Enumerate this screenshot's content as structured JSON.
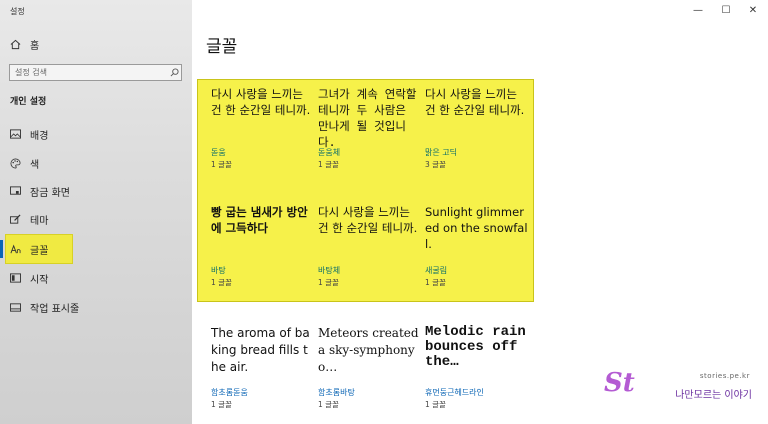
{
  "app_title": "설정",
  "sidebar": {
    "home_label": "홈",
    "search_placeholder": "설정 검색",
    "section_title": "개인 설정",
    "items": [
      {
        "label": "배경",
        "icon": "picture-icon"
      },
      {
        "label": "색",
        "icon": "palette-icon"
      },
      {
        "label": "잠금 화면",
        "icon": "lock-screen-icon"
      },
      {
        "label": "테마",
        "icon": "brush-icon"
      },
      {
        "label": "글꼴",
        "icon": "font-icon",
        "active": true
      },
      {
        "label": "시작",
        "icon": "start-icon"
      },
      {
        "label": "작업 표시줄",
        "icon": "taskbar-icon"
      }
    ]
  },
  "window_controls": {
    "minimize": "—",
    "maximize": "☐",
    "close": "✕"
  },
  "main": {
    "title": "글꼴",
    "fonts": [
      {
        "sample": "다시 사랑을 느끼는 건 한 순간일 테니까.",
        "name": "돋움",
        "count": "1 글꼴"
      },
      {
        "sample": "그녀가 계속 연락할 테니까 두 사람은 만나게 될 것입니다.",
        "name": "돋움체",
        "count": "1 글꼴"
      },
      {
        "sample": "다시 사랑을 느끼는 건 한 순간일 테니까.",
        "name": "맑은 고딕",
        "count": "3 글꼴"
      },
      {
        "sample": "빵 굽는 냄새가 방안에 그득하다",
        "name": "바탕",
        "count": "1 글꼴"
      },
      {
        "sample": "다시 사랑을 느끼는 건 한 순간일 테니까.",
        "name": "바탕체",
        "count": "1 글꼴"
      },
      {
        "sample": "Sunlight glimmered on the snowfall.",
        "name": "새굴림",
        "count": "1 글꼴"
      },
      {
        "sample": "The aroma of baking bread fills the air.",
        "name": "함초롬돋움",
        "count": "1 글꼴"
      },
      {
        "sample": "Meteors created a sky-symphony o…",
        "name": "함초롬바탕",
        "count": "1 글꼴"
      },
      {
        "sample": "Melodic rain bounces off the…",
        "name": "휴먼둥근헤드라인",
        "count": "1 글꼴"
      }
    ]
  },
  "watermark": {
    "logo": "St",
    "url": "stories.pe.kr",
    "name": "나만모르는 이야기"
  },
  "colors": {
    "highlight": "#f6f14a",
    "accent": "#0a64b4",
    "font_name_green": "#0a6d6a"
  }
}
